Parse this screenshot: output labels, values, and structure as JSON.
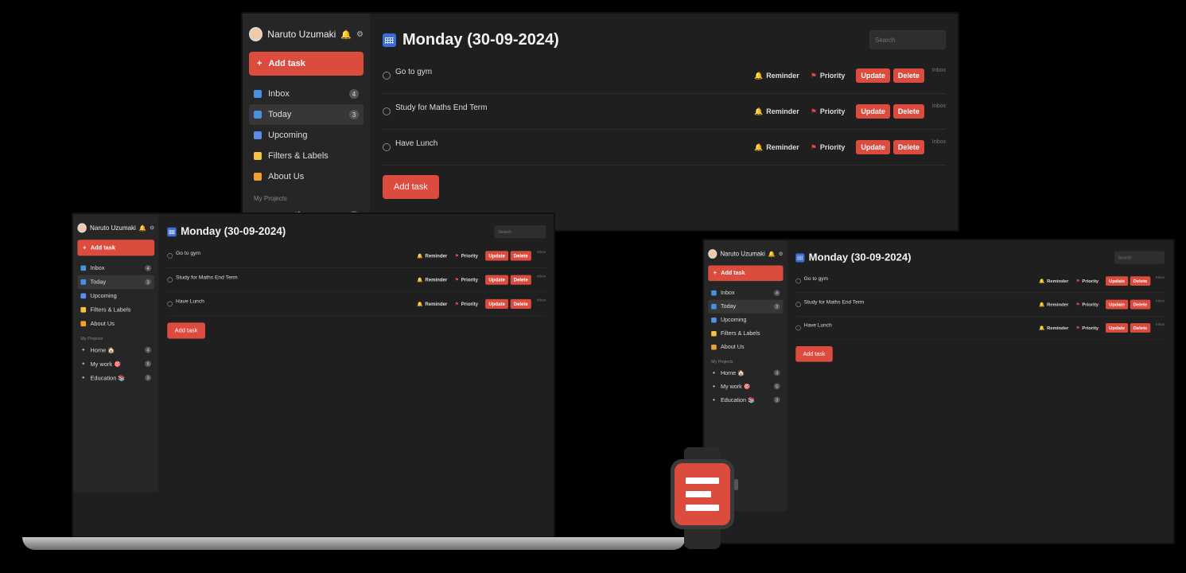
{
  "app": {
    "user_name": "Naruto Uzumaki",
    "add_task_label": "Add task",
    "nav": [
      {
        "label": "Inbox",
        "count": "4",
        "icon": "inbox-icon",
        "color": "#4a90e2"
      },
      {
        "label": "Today",
        "count": "3",
        "icon": "calendar-today-icon",
        "color": "#4a90e2"
      },
      {
        "label": "Upcoming",
        "count": "",
        "icon": "calendar-upcoming-icon",
        "color": "#5b8def"
      },
      {
        "label": "Filters & Labels",
        "count": "",
        "icon": "tag-icon",
        "color": "#f5c242"
      },
      {
        "label": "About Us",
        "count": "",
        "icon": "people-icon",
        "color": "#f0a030"
      }
    ],
    "projects_title": "My Projects",
    "projects": [
      {
        "label": "Home 🏠",
        "count": "4"
      },
      {
        "label": "My work 🎯",
        "count": "5"
      },
      {
        "label": "Education 📚",
        "count": "3"
      }
    ],
    "page_title": "Monday (30-09-2024)",
    "search_placeholder": "Search",
    "tasks": [
      {
        "name": "Go to gym",
        "project": "Inbox"
      },
      {
        "name": "Study for Maths End Term",
        "project": "Inbox"
      },
      {
        "name": "Have Lunch",
        "project": "Inbox"
      }
    ],
    "reminder_label": "Reminder",
    "priority_label": "Priority",
    "update_label": "Update",
    "delete_label": "Delete",
    "add_task_button": "Add task",
    "colors": {
      "accent": "#db4c3f",
      "sidebar": "#262626",
      "main": "#1f1f1f"
    }
  }
}
